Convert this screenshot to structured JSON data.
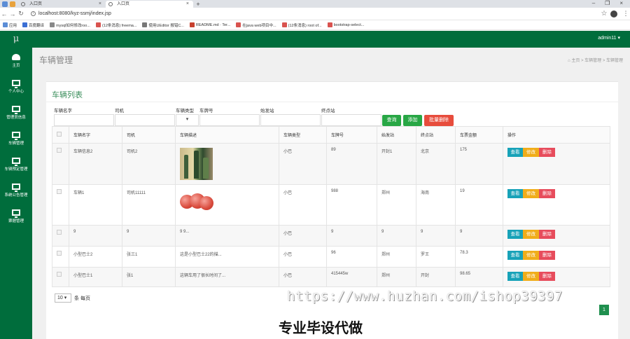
{
  "browser": {
    "tabs": [
      {
        "title": "入口页",
        "active": false
      },
      {
        "title": "入口页",
        "active": true
      }
    ],
    "url": "localhost:8080/kyz-ssmj/index.jsp",
    "bookmarks": [
      {
        "label": "应用",
        "color": "#5b8dd6"
      },
      {
        "label": "百度翻译",
        "color": "#3b6fd4"
      },
      {
        "label": "mysql如何修改roo...",
        "color": "#888888"
      },
      {
        "label": "(12条消息) freema...",
        "color": "#d9534f"
      },
      {
        "label": "使用UEditor 报错C...",
        "color": "#777777"
      },
      {
        "label": "README.md · Ter...",
        "color": "#c7402e"
      },
      {
        "label": "在java web项目中...",
        "color": "#d9534f"
      },
      {
        "label": "(12条消息) root of...",
        "color": "#d9534f"
      },
      {
        "label": "bootstrap-select...",
        "color": "#d9534f"
      }
    ]
  },
  "app": {
    "logo": "μ",
    "user": "admin11 ▾",
    "sidebar": [
      {
        "label": "主页",
        "icon": "dashboard-icon"
      },
      {
        "label": "个人中心",
        "icon": "monitor-icon"
      },
      {
        "label": "管理员信息",
        "icon": "monitor-icon"
      },
      {
        "label": "车辆管理",
        "icon": "monitor-icon"
      },
      {
        "label": "车辆预定管理",
        "icon": "monitor-icon"
      },
      {
        "label": "系统公告管理",
        "icon": "monitor-icon"
      },
      {
        "label": "票据管理",
        "icon": "monitor-icon"
      }
    ],
    "page_title": "车辆管理",
    "breadcrumb": "⌂ 主页 > 车辆管理 > 车辆管理",
    "panel_title": "车辆列表",
    "filters": {
      "labels": [
        "车辆名字",
        "司机",
        "车辆类型",
        "车牌号",
        "始发站",
        "终点站"
      ],
      "select_value": "▾",
      "buttons": {
        "search": "查询",
        "add": "添加",
        "batch_delete": "批量删除"
      }
    },
    "table": {
      "headers": [
        "",
        "车辆名字",
        "司机",
        "车辆描述",
        "车辆类型",
        "车牌号",
        "始发站",
        "终点站",
        "车票金额",
        "操作"
      ],
      "rows": [
        {
          "name": "车辆信息2",
          "driver": "司机2",
          "desc": "",
          "image": "bottles",
          "type": "小巴",
          "plate": "89",
          "from": "开封1",
          "to": "北京",
          "price": "175"
        },
        {
          "name": "车辆1",
          "driver": "司机11111",
          "desc": "",
          "image": "apples",
          "type": "小巴",
          "plate": "988",
          "from": "郑州",
          "to": "海南",
          "price": "19"
        },
        {
          "name": "9",
          "driver": "9",
          "desc": "9 9...",
          "image": "",
          "type": "小巴",
          "plate": "9",
          "from": "9",
          "to": "9",
          "price": "9"
        },
        {
          "name": "小型巴士2",
          "driver": "张三1",
          "desc": "这是小型巴士22的描...",
          "image": "",
          "type": "小巴",
          "plate": "96",
          "from": "郑州",
          "to": "罗王",
          "price": "78.3"
        },
        {
          "name": "小型巴士1",
          "driver": "张1",
          "desc": "这辆车用了很长时间了...",
          "image": "",
          "type": "小巴",
          "plate": "415445w",
          "from": "郑州",
          "to": "开封",
          "price": "98.65"
        }
      ],
      "op_labels": {
        "view": "查看",
        "edit": "修改",
        "delete": "删除"
      }
    },
    "pager": {
      "page_size": "10 ▾",
      "per_page_label": "条 每页",
      "current_page": "1"
    }
  },
  "overlay": {
    "watermark": "https://www.huzhan.com/ishop39397",
    "stamp": "专业毕设代做"
  },
  "colors": {
    "brand_green": "#006d3c",
    "btn_green": "#28a745",
    "btn_red": "#e74c3c",
    "op_view": "#17a2b8",
    "op_edit": "#f0ad1a",
    "op_delete": "#e74c5c"
  }
}
